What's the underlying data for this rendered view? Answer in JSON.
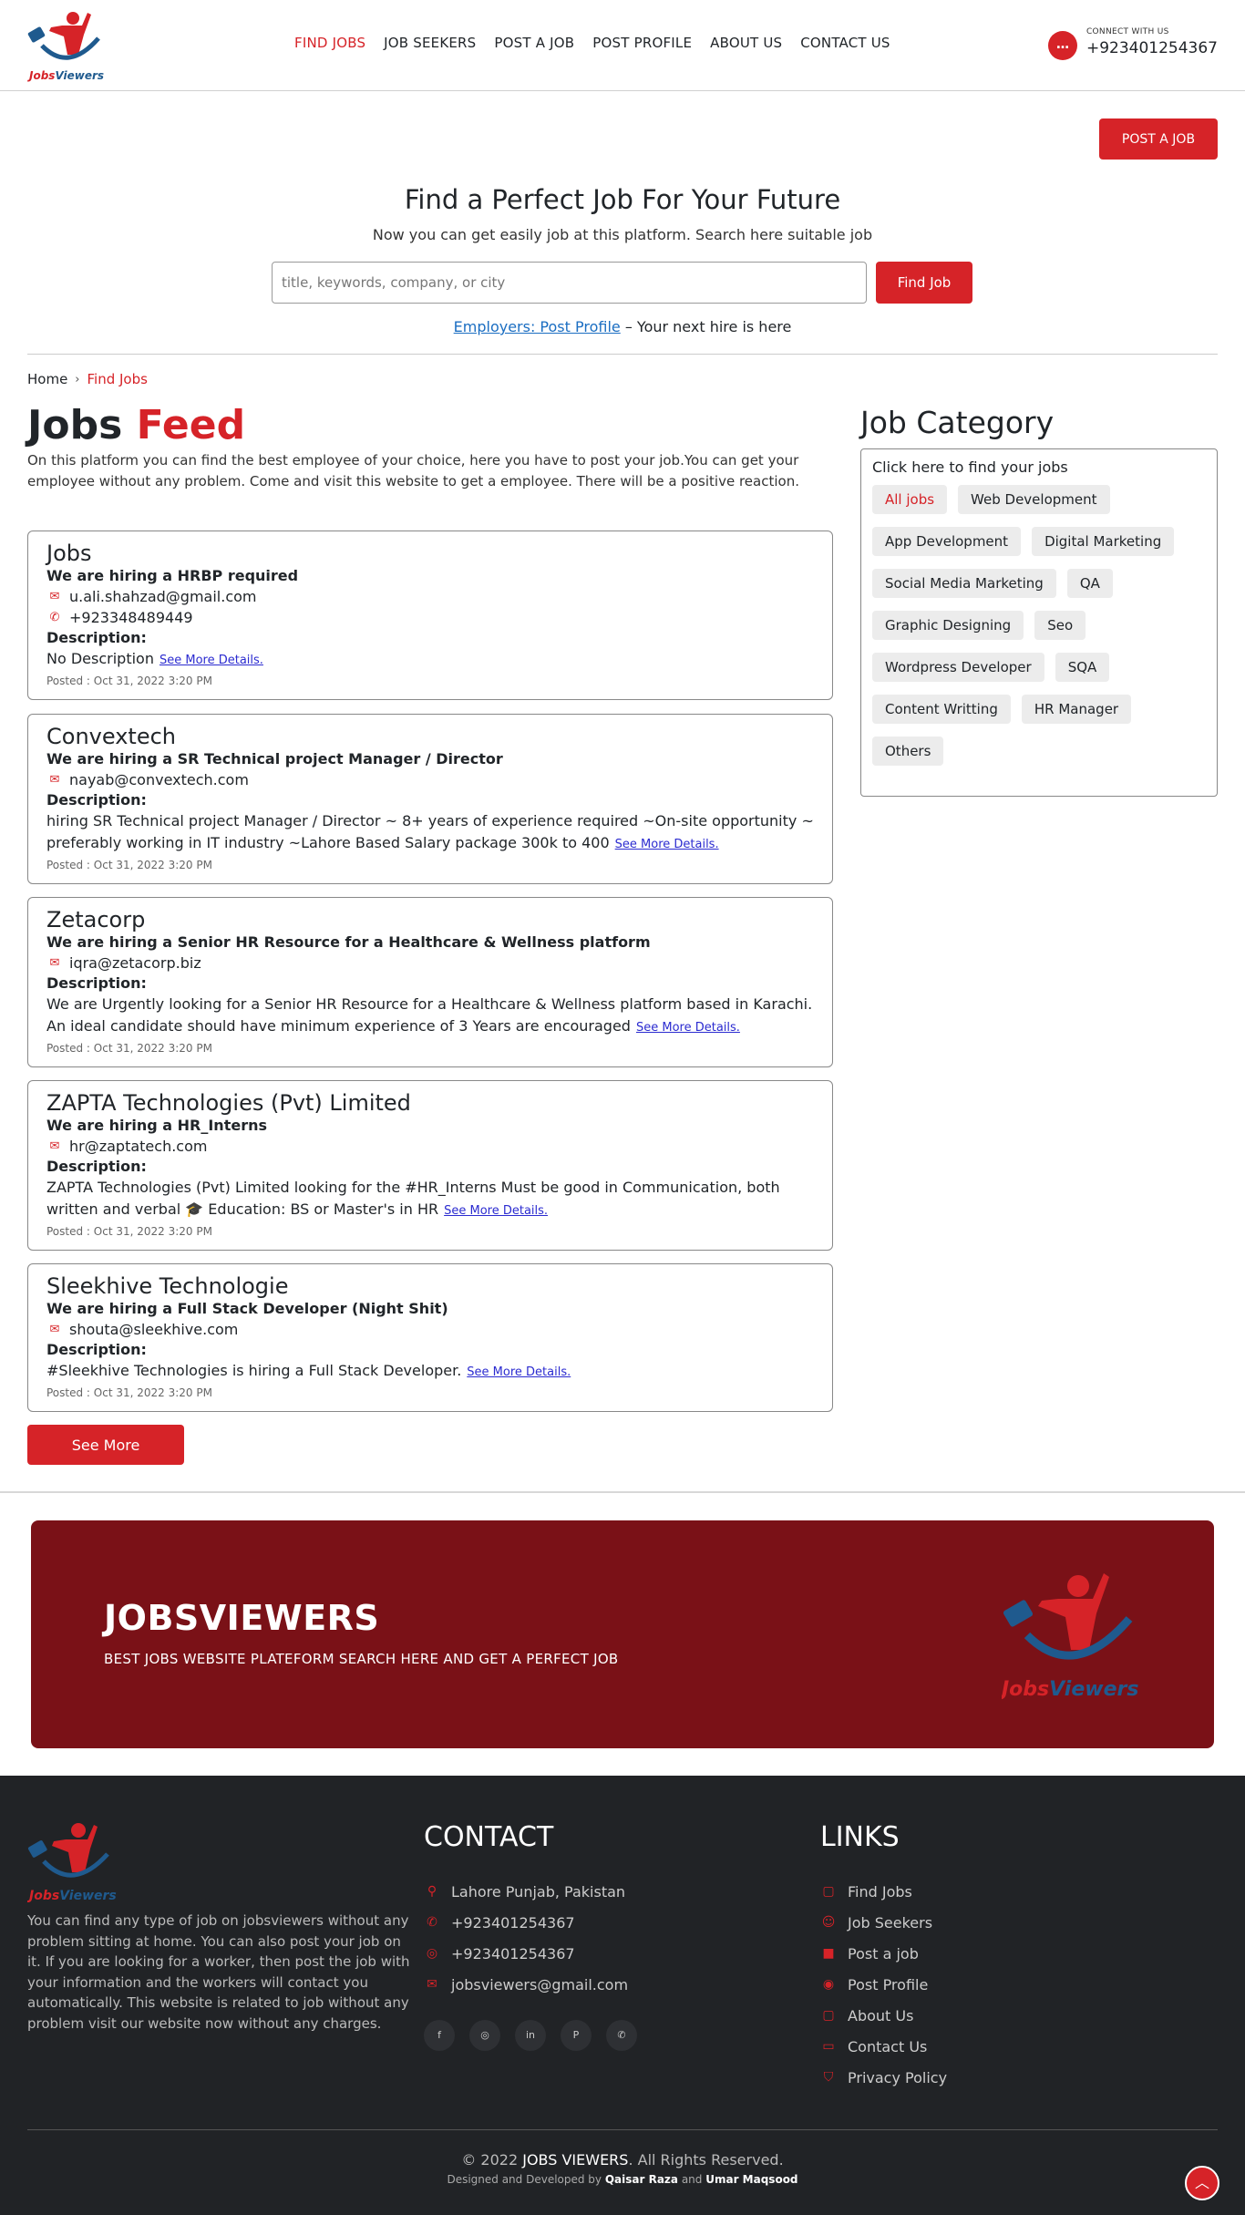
{
  "header": {
    "logo_text_1": "Jobs",
    "logo_text_2": "Viewers",
    "nav": [
      {
        "label": "FIND JOBS"
      },
      {
        "label": "JOB SEEKERS"
      },
      {
        "label": "POST A JOB"
      },
      {
        "label": "POST PROFILE"
      },
      {
        "label": "ABOUT US"
      },
      {
        "label": "CONTACT US"
      }
    ],
    "connect_label": "CONNECT WITH US",
    "connect_phone": "+923401254367"
  },
  "hero": {
    "post_button": "POST A JOB",
    "title": "Find a Perfect Job For Your Future",
    "subtitle": "Now you can get easily job at this platform. Search here suitable job",
    "search_placeholder": "title, keywords, company, or city",
    "find_button": "Find Job",
    "employers_link": "Employers: Post Profile",
    "employers_text": " – Your next hire is here"
  },
  "breadcrumb": {
    "home": "Home",
    "current": "Find Jobs"
  },
  "feed": {
    "title_a": "Jobs",
    "title_b": "Feed",
    "description": "On this platform you can find the best employee of your choice, here you have to post your job.You can get your employee without any problem. Come and visit this website to get a employee. There will be a positive reaction.",
    "see_more_details": "See More Details.",
    "desc_label": "Description:",
    "jobs": [
      {
        "company": "Jobs",
        "hiring": "We are hiring a HRBP required",
        "email": "u.ali.shahzad@gmail.com",
        "phone": "+923348489449",
        "description": "No Description",
        "posted": "Posted : Oct 31, 2022 3:20 PM"
      },
      {
        "company": "Convextech",
        "hiring": "We are hiring a SR Technical project Manager / Director",
        "email": "nayab@convextech.com",
        "description": "hiring SR Technical project Manager / Director ~ 8+ years of experience required ~On-site opportunity ~ preferably working in IT industry ~Lahore Based Salary package 300k to 400",
        "posted": "Posted : Oct 31, 2022 3:20 PM"
      },
      {
        "company": "Zetacorp",
        "hiring": "We are hiring a Senior HR Resource for a Healthcare & Wellness platform",
        "email": "iqra@zetacorp.biz",
        "description": "We are Urgently looking for a Senior HR Resource for a Healthcare & Wellness platform based in Karachi. An ideal candidate should have minimum experience of 3 Years are encouraged",
        "posted": "Posted : Oct 31, 2022 3:20 PM"
      },
      {
        "company": "ZAPTA Technologies (Pvt) Limited",
        "hiring": "We are hiring a HR_Interns",
        "email": "hr@zaptatech.com",
        "description": "ZAPTA Technologies (Pvt) Limited looking for the #HR_Interns Must be good in Communication, both written and verbal 🎓 Education: BS or Master's in HR",
        "posted": "Posted : Oct 31, 2022 3:20 PM"
      },
      {
        "company": "Sleekhive Technologie",
        "hiring": "We are hiring a Full Stack Developer (Night Shit)",
        "email": "shouta@sleekhive.com",
        "description": "#Sleekhive Technologies is hiring a Full Stack Developer.",
        "posted": "Posted : Oct 31, 2022 3:20 PM"
      }
    ],
    "see_more_button": "See More"
  },
  "category": {
    "title": "Job Category",
    "hint": "Click here to find your jobs",
    "tags": [
      "All jobs",
      "Web Development",
      "App Development",
      "Digital Marketing",
      "Social Media Marketing",
      "QA",
      "Graphic Designing",
      "Seo",
      "Wordpress Developer",
      "SQA",
      "Content Writting",
      "HR Manager",
      "Others"
    ]
  },
  "banner": {
    "title": "JOBSVIEWERS",
    "subtitle": "BEST JOBS WEBSITE PLATEFORM SEARCH HERE AND GET A PERFECT JOB"
  },
  "footer": {
    "about": "You can find any type of job on jobsviewers without any problem sitting at home. You can also post your job on it. If you are looking for a worker, then post the job with your information and the workers will contact you automatically. This website is related to job without any problem visit our website now without any charges.",
    "contact_title": "CONTACT",
    "contact": [
      {
        "icon": "map-pin-icon",
        "text": "Lahore Punjab, Pakistan"
      },
      {
        "icon": "phone-icon",
        "text": "+923401254367"
      },
      {
        "icon": "whatsapp-icon",
        "text": "+923401254367"
      },
      {
        "icon": "mail-icon",
        "text": "jobsviewers@gmail.com"
      }
    ],
    "socials": [
      "facebook-icon",
      "instagram-icon",
      "linkedin-icon",
      "pinterest-icon",
      "whatsapp-icon"
    ],
    "links_title": "LINKS",
    "links": [
      "Find Jobs",
      "Job Seekers",
      "Post a job",
      "Post Profile",
      "About Us",
      "Contact Us",
      "Privacy Policy"
    ],
    "copy_a": "© 2022 ",
    "copy_brand": "JOBS VIEWERS",
    "copy_b": ". All Rights Reserved.",
    "dev_a": "Designed and Developed by ",
    "dev_name1": "Qaisar Raza",
    "dev_and": " and ",
    "dev_name2": "Umar Maqsood"
  },
  "colors": {
    "accent": "#d62328",
    "banner": "#7a1117",
    "footer": "#212326",
    "logo_blue": "#1f5a8e"
  }
}
